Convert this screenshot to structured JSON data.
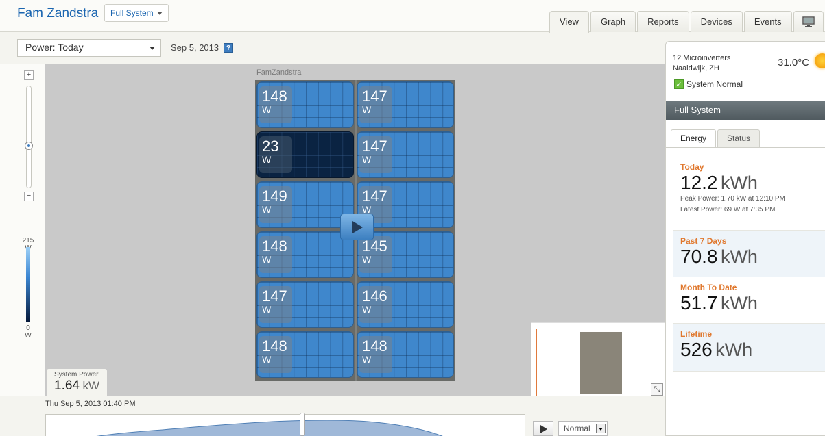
{
  "header": {
    "site_name": "Fam Zandstra",
    "system_selector": "Full System",
    "tabs": [
      "View",
      "Graph",
      "Reports",
      "Devices",
      "Events"
    ],
    "icon_tabs": [
      "monitor-icon",
      "gear-icon"
    ]
  },
  "toolbar": {
    "power_selector": "Power: Today",
    "date": "Sep 5, 2013",
    "help_label": "?"
  },
  "zoom": {
    "plus": "+",
    "minus": "−"
  },
  "legend": {
    "max_value": "215",
    "max_unit": "W",
    "min_value": "0",
    "min_unit": "W"
  },
  "array": {
    "title": "FamZandstra",
    "panels": [
      {
        "value": "148",
        "unit": "W",
        "status": "normal"
      },
      {
        "value": "147",
        "unit": "W",
        "status": "normal"
      },
      {
        "value": "23",
        "unit": "W",
        "status": "low"
      },
      {
        "value": "147",
        "unit": "W",
        "status": "normal"
      },
      {
        "value": "149",
        "unit": "W",
        "status": "normal"
      },
      {
        "value": "147",
        "unit": "W",
        "status": "normal"
      },
      {
        "value": "148",
        "unit": "W",
        "status": "normal"
      },
      {
        "value": "145",
        "unit": "W",
        "status": "normal"
      },
      {
        "value": "147",
        "unit": "W",
        "status": "normal"
      },
      {
        "value": "146",
        "unit": "W",
        "status": "normal"
      },
      {
        "value": "148",
        "unit": "W",
        "status": "normal"
      },
      {
        "value": "148",
        "unit": "W",
        "status": "normal"
      }
    ]
  },
  "system_power": {
    "label": "System Power",
    "value": "1.64",
    "unit": "kW"
  },
  "timeline": {
    "timestamp": "Thu Sep 5, 2013 01:40 PM",
    "speed": "Normal"
  },
  "site_info": {
    "line1": "12 Microinverters",
    "line2": "Naaldwijk, ZH",
    "temperature": "31.0°C",
    "status": "System Normal"
  },
  "sidebar": {
    "section_title": "Full System",
    "tabs": [
      "Energy",
      "Status"
    ],
    "today": {
      "label": "Today",
      "value": "12.2",
      "unit": "kWh",
      "peak": "Peak Power: 1.70 kW at 12:10 PM",
      "latest": "Latest Power: 69 W at 7:35 PM"
    },
    "past7": {
      "label": "Past 7 Days",
      "value": "70.8",
      "unit": "kWh"
    },
    "month": {
      "label": "Month To Date",
      "value": "51.7",
      "unit": "kWh"
    },
    "lifetime": {
      "label": "Lifetime",
      "value": "526",
      "unit": "kWh"
    }
  },
  "colors": {
    "brand_blue": "#1a65b0",
    "panel_blue": "#3f87cc",
    "panel_low": "#0a2342",
    "accent_orange": "#e0782e"
  }
}
